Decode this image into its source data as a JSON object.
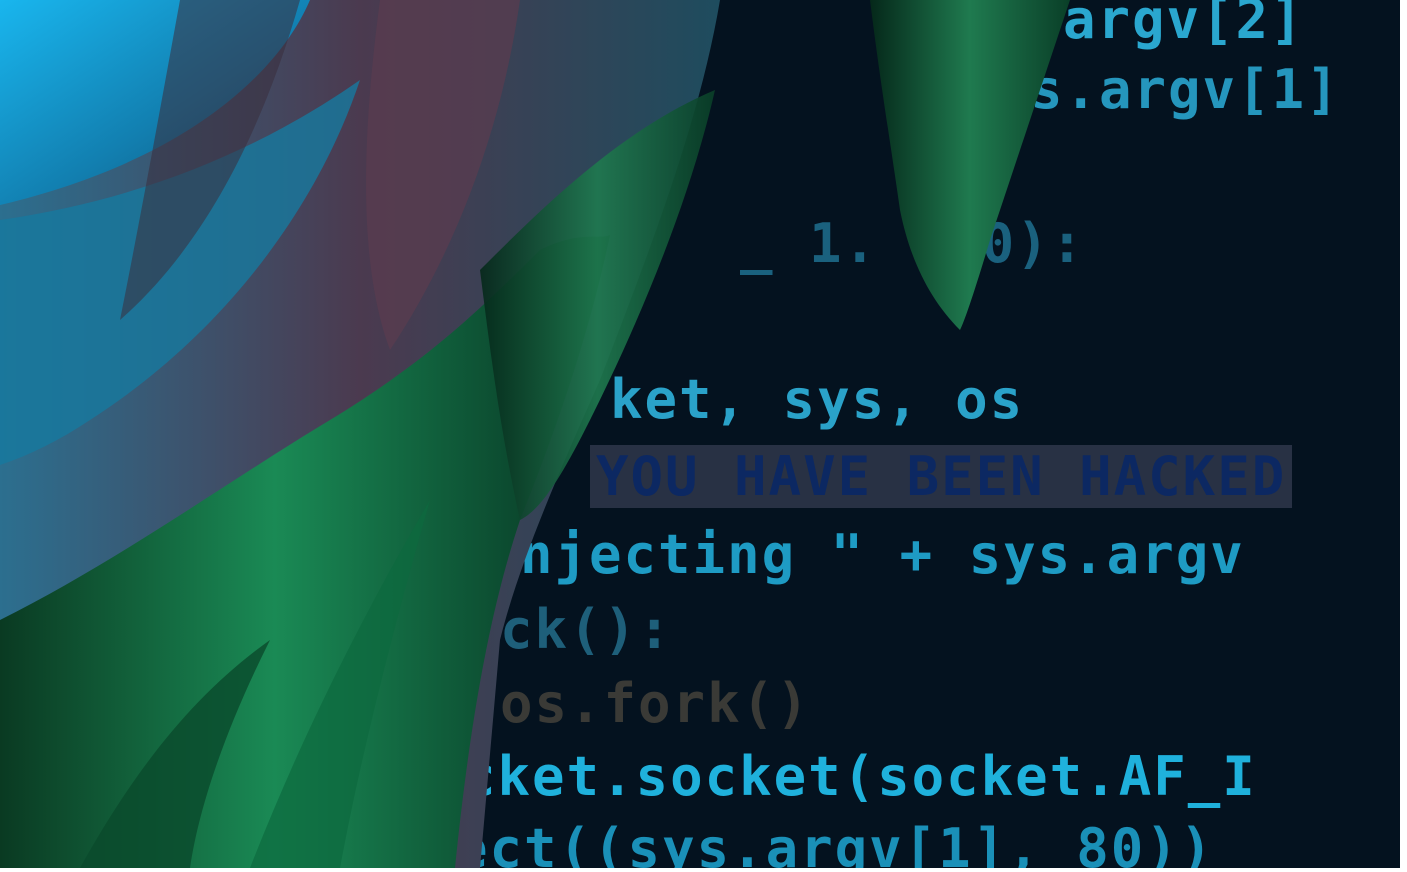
{
  "code_lines": [
    "argv[2]",
    "s.argv[1]",
    "_ 1. 000):",
    "ket, sys, os",
    "YOU HAVE BEEN HACKED",
    "njecting \" + sys.argv",
    "ck():",
    "os.fork()",
    "cket.socket(socket.AF_I",
    "ect((sys.argv[1], 80))"
  ],
  "colors": {
    "background": "#04121f",
    "code_cyan": "#1fb1dc",
    "fabric_blue": "#1aa8df",
    "fabric_green": "#0f5a35",
    "fabric_purple": "#4a3a4c"
  }
}
